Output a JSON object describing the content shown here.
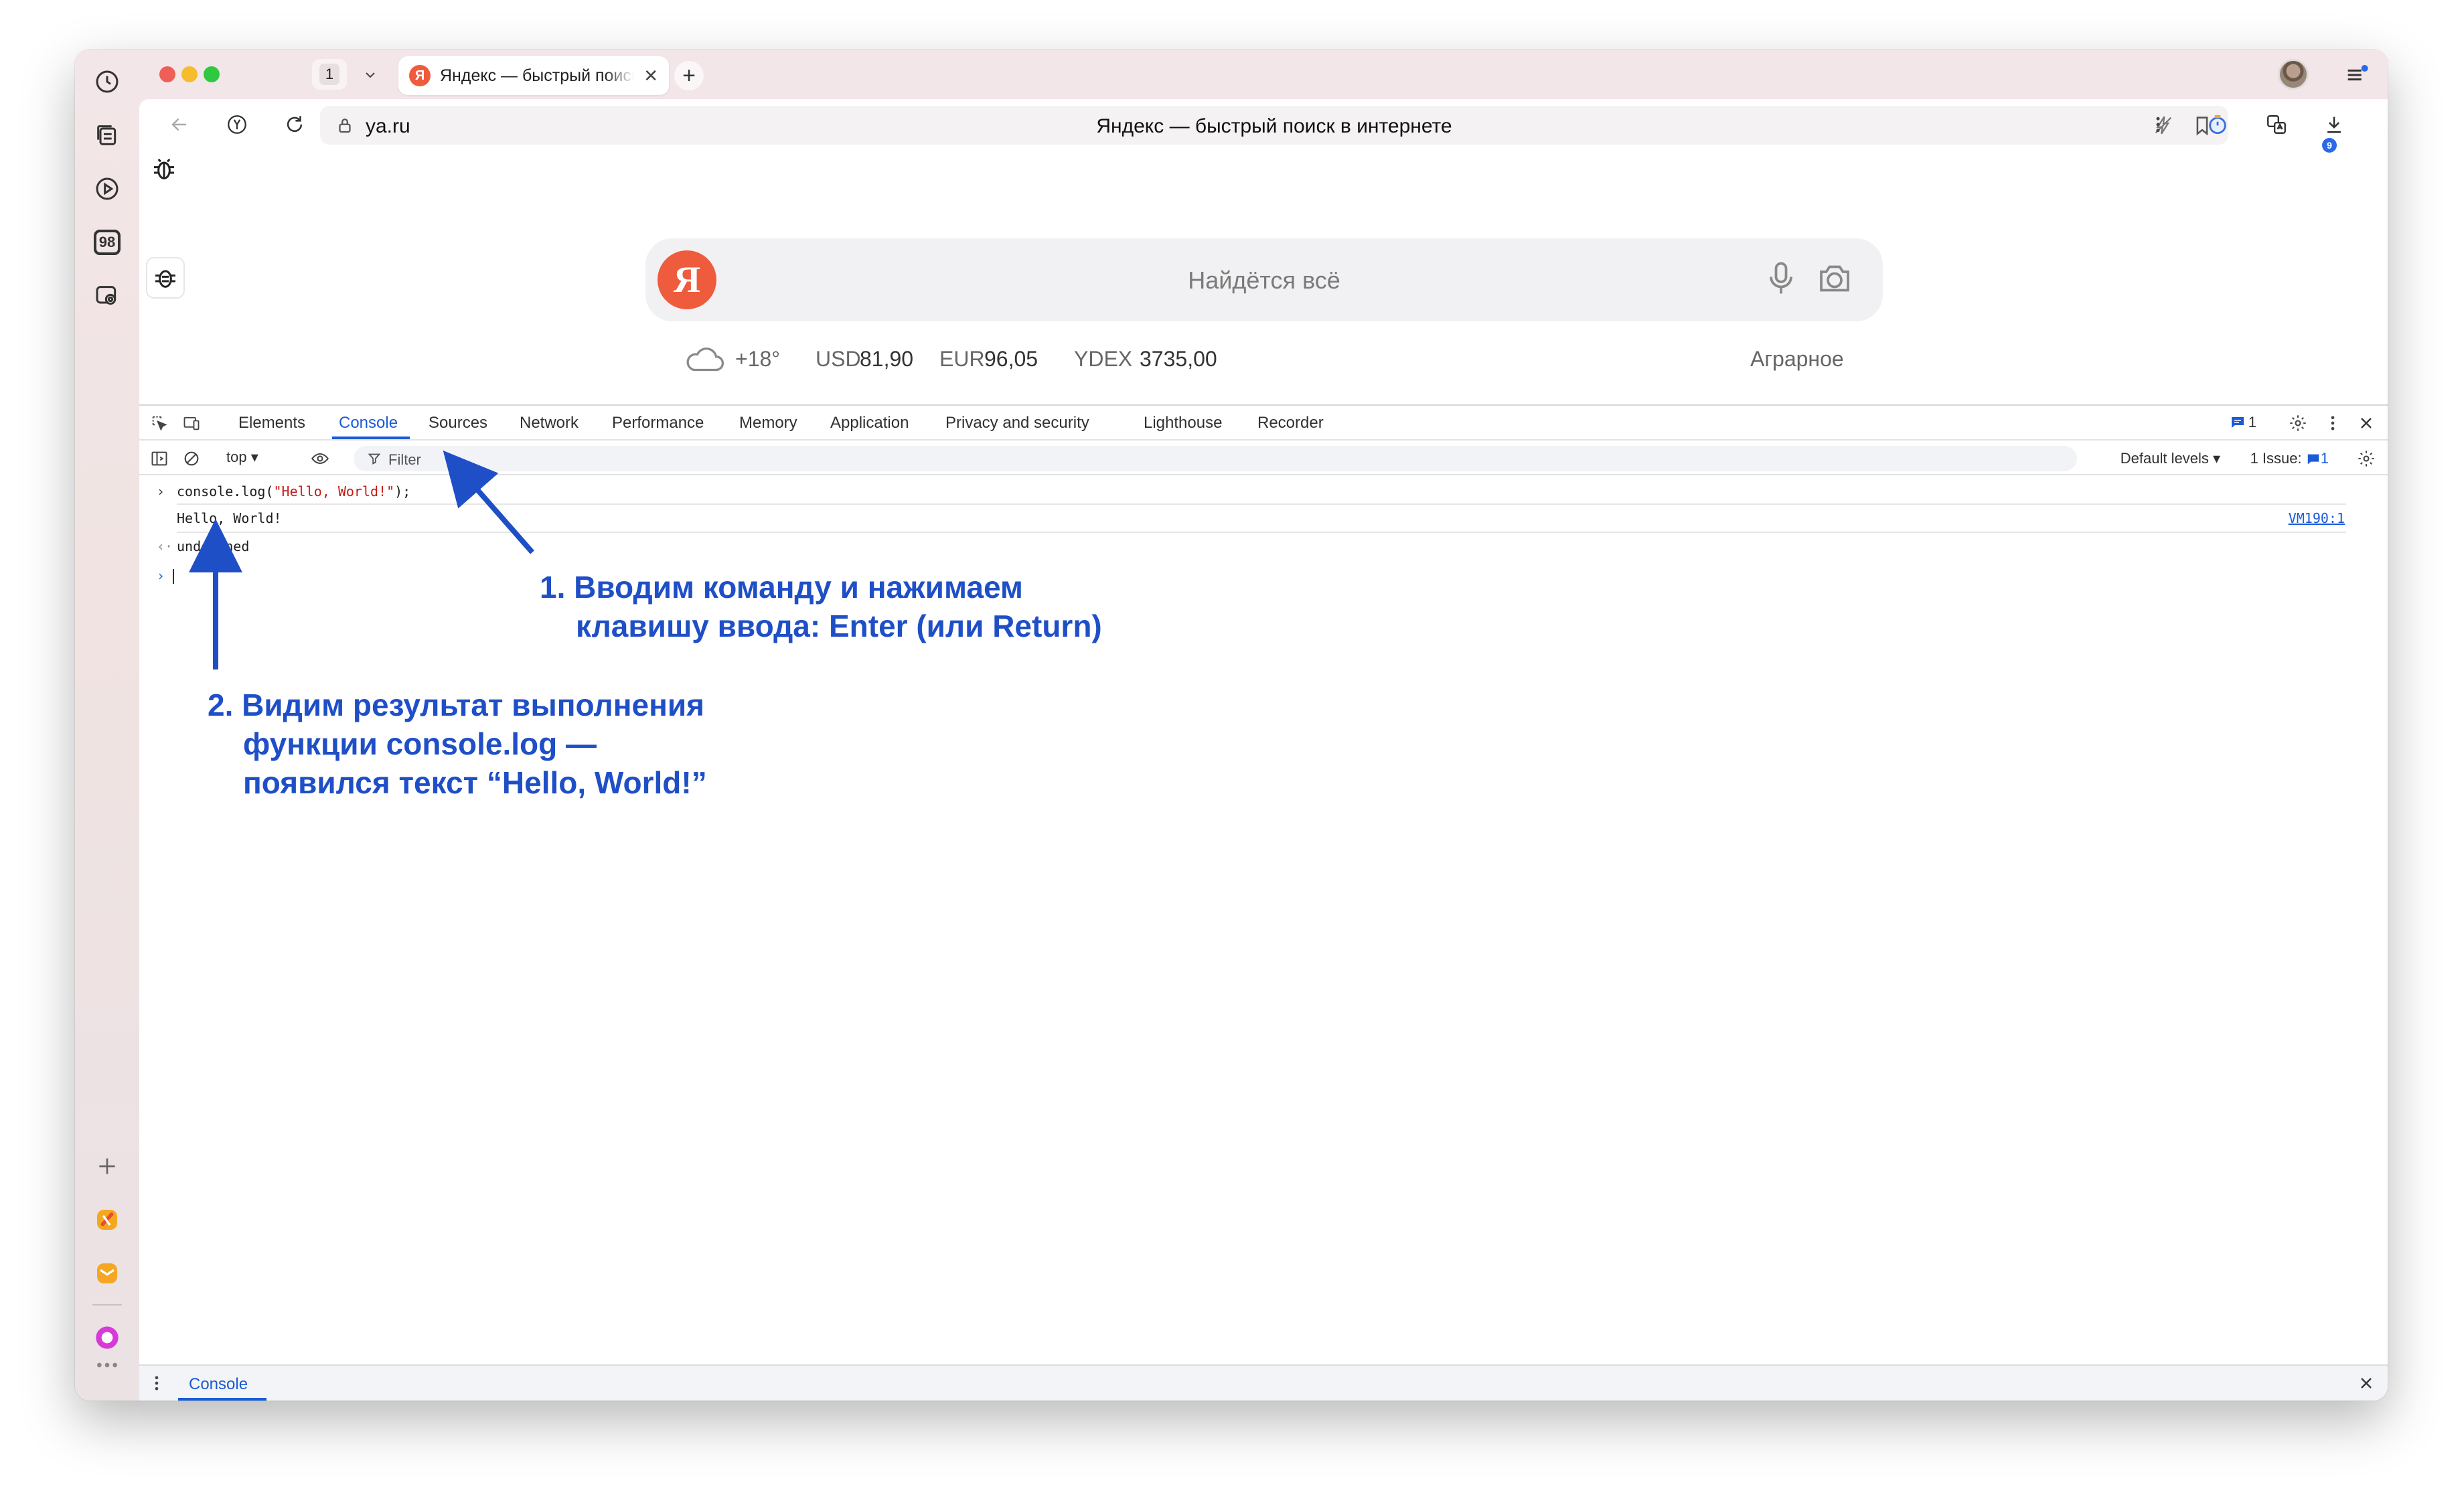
{
  "tabbar": {
    "tab_count": "1",
    "tab_title": "Яндекс — быстрый поиск в интернете",
    "tab_favicon": "Я",
    "new_tab": "+",
    "close": "✕"
  },
  "address": {
    "host": "ya.ru",
    "title": "Яндекс — быстрый поиск в интернете",
    "download_badge": "9"
  },
  "sidebar": {
    "badge_number": "98"
  },
  "page": {
    "logo": "Я",
    "search_placeholder": "Найдётся всё",
    "weather": "+18°",
    "usd_label": "USD",
    "usd_value": "81,90",
    "eur_label": "EUR",
    "eur_value": "96,05",
    "ydex_label": "YDEX",
    "ydex_value": "3735,00",
    "location": "Аграрное"
  },
  "devtools": {
    "tabs": [
      "Elements",
      "Console",
      "Sources",
      "Network",
      "Performance",
      "Memory",
      "Application",
      "Privacy and security",
      "Lighthouse",
      "Recorder"
    ],
    "active_tab": "Console",
    "message_count": "1",
    "context": "top",
    "filter_placeholder": "Filter",
    "levels": "Default levels",
    "issues_label": "1 Issue:",
    "issues_count": "1",
    "console": {
      "input_prefix": "console.log(",
      "input_string": "\"Hello, World!\"",
      "input_suffix": ");",
      "output": "Hello, World!",
      "source_link": "VM190:1",
      "return_value": "undefined"
    },
    "drawer_tab": "Console"
  },
  "annotations": {
    "note1_line1": "1. Вводим команду и нажимаем",
    "note1_line2": "клавишу ввода: Enter (или Return)",
    "note2_line1": "2. Видим результат выполнения",
    "note2_line2": "функции console.log —",
    "note2_line3": "появился текст “Hello, World!”"
  },
  "colors": {
    "accent": "#1a5bd6",
    "annotation": "#1f4fc7",
    "yandex_red": "#ef5b3d"
  }
}
